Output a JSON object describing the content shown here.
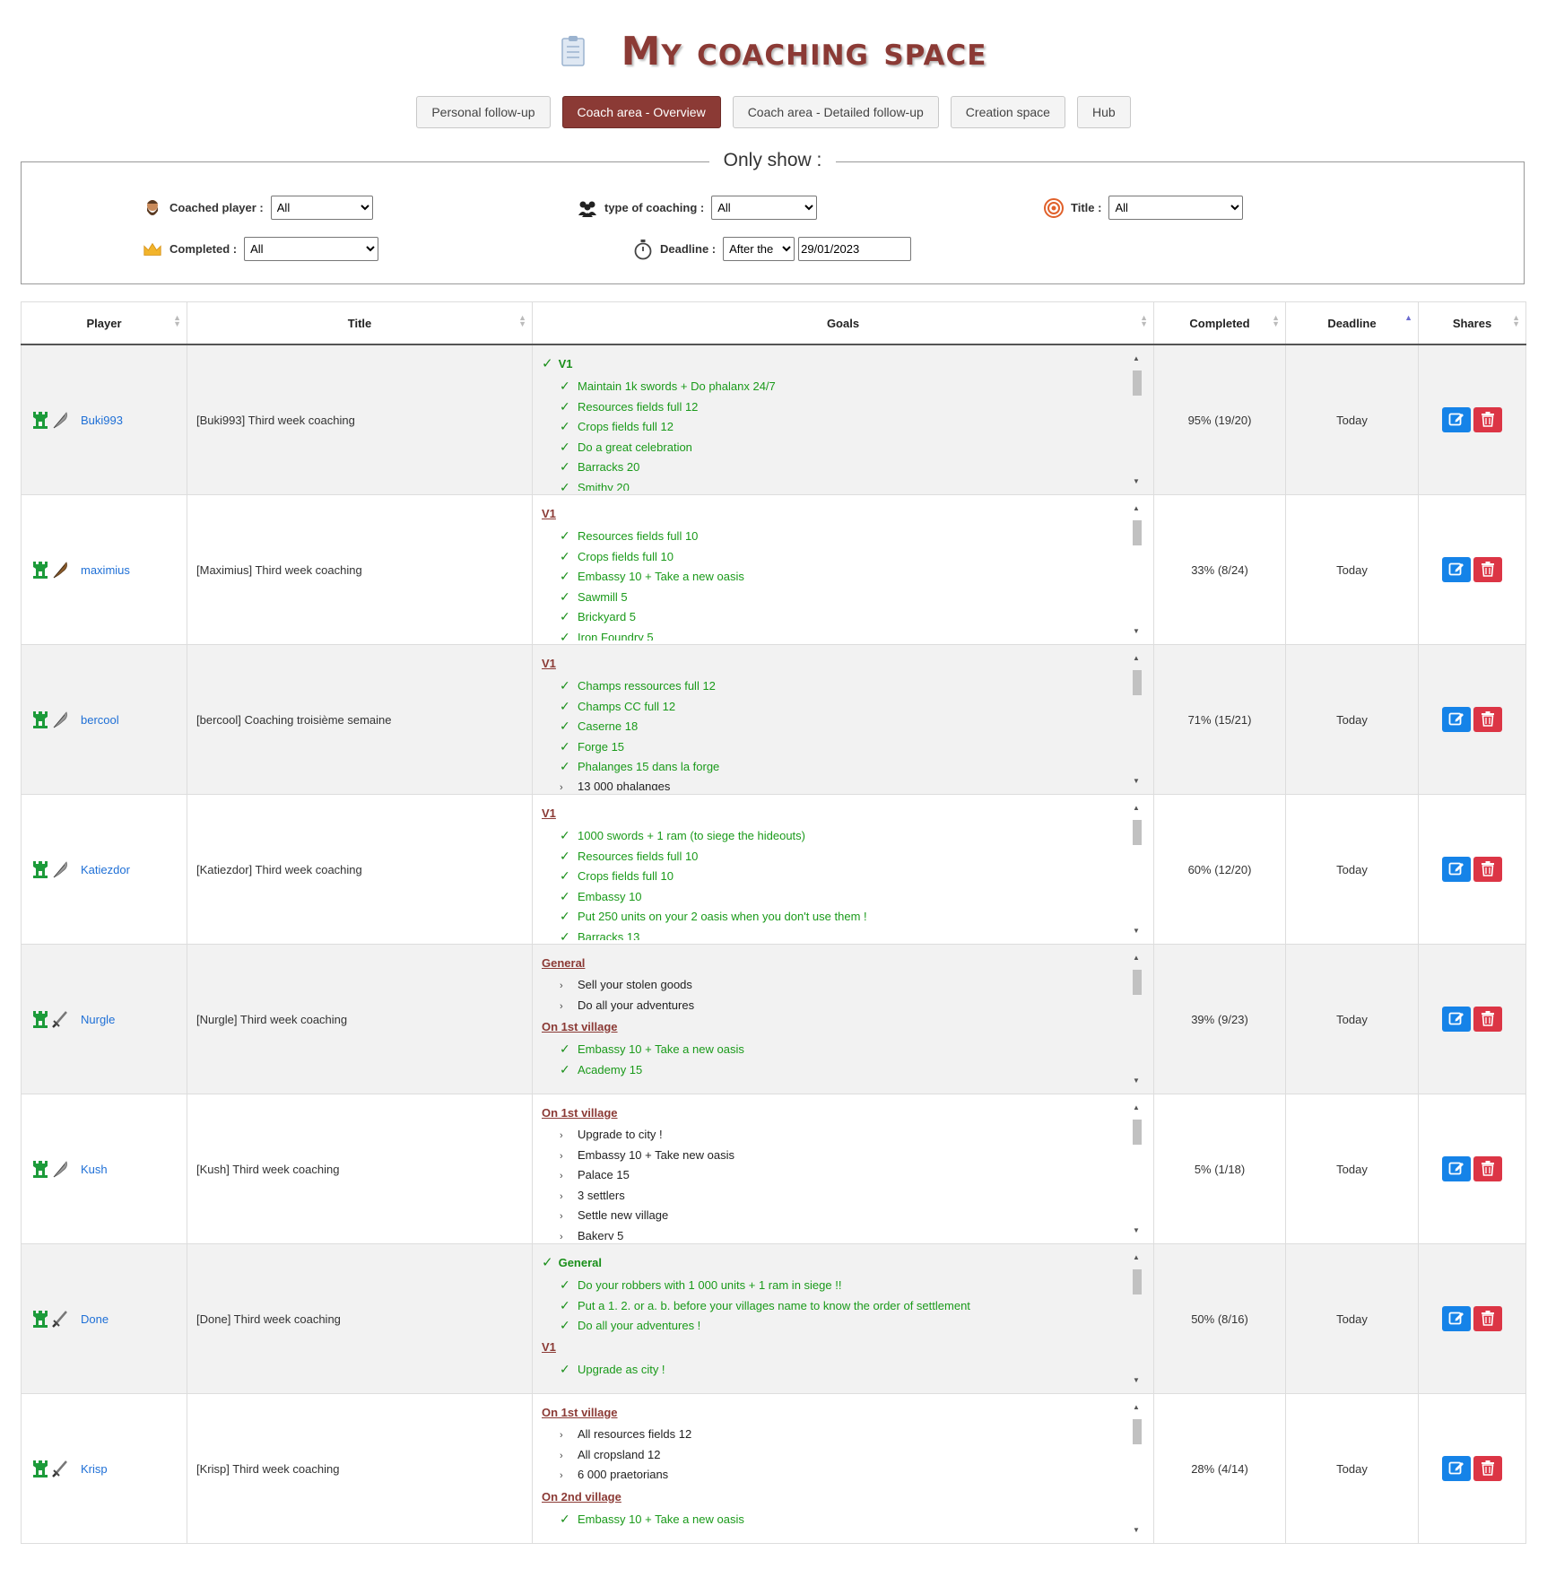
{
  "page": {
    "title": "My coaching space"
  },
  "tabs": [
    {
      "label": "Personal follow-up",
      "active": false
    },
    {
      "label": "Coach area - Overview",
      "active": true
    },
    {
      "label": "Coach area - Detailed follow-up",
      "active": false
    },
    {
      "label": "Creation space",
      "active": false
    },
    {
      "label": "Hub",
      "active": false
    }
  ],
  "filters": {
    "legend": "Only show :",
    "coached_player": {
      "label": "Coached player :",
      "value": "All"
    },
    "type": {
      "label": "type of coaching :",
      "value": "All"
    },
    "title": {
      "label": "Title :",
      "value": "All"
    },
    "completed": {
      "label": "Completed :",
      "value": "All"
    },
    "deadline": {
      "label": "Deadline :",
      "mode": "After the",
      "date": "29/01/2023"
    }
  },
  "table": {
    "headers": [
      "Player",
      "Title",
      "Goals",
      "Completed",
      "Deadline",
      "Shares"
    ],
    "rows": [
      {
        "player": "Buki993",
        "title": "[Buki993] Third week coaching",
        "completed": "95% (19/20)",
        "deadline": "Today",
        "goals": [
          {
            "type": "head",
            "text": "V1",
            "done": true
          },
          {
            "type": "item",
            "text": "Maintain 1k swords + Do phalanx 24/7",
            "done": true
          },
          {
            "type": "item",
            "text": "Resources fields full 12",
            "done": true
          },
          {
            "type": "item",
            "text": "Crops fields full 12",
            "done": true
          },
          {
            "type": "item",
            "text": "Do a great celebration",
            "done": true
          },
          {
            "type": "item",
            "text": "Barracks 20",
            "done": true
          },
          {
            "type": "item",
            "text": "Smithy 20",
            "done": true
          }
        ]
      },
      {
        "player": "maximius",
        "title": "[Maximius] Third week coaching",
        "completed": "33% (8/24)",
        "deadline": "Today",
        "goals": [
          {
            "type": "head",
            "text": "V1",
            "done": false
          },
          {
            "type": "item",
            "text": "Resources fields full 10",
            "done": true
          },
          {
            "type": "item",
            "text": "Crops fields full 10",
            "done": true
          },
          {
            "type": "item",
            "text": "Embassy 10 + Take a new oasis",
            "done": true
          },
          {
            "type": "item",
            "text": "Sawmill 5",
            "done": true
          },
          {
            "type": "item",
            "text": "Brickyard 5",
            "done": true
          },
          {
            "type": "item",
            "text": "Iron Foundry 5",
            "done": true
          }
        ]
      },
      {
        "player": "bercool",
        "title": "[bercool] Coaching troisième semaine",
        "completed": "71% (15/21)",
        "deadline": "Today",
        "goals": [
          {
            "type": "head",
            "text": "V1",
            "done": false
          },
          {
            "type": "item",
            "text": "Champs ressources full 12",
            "done": true
          },
          {
            "type": "item",
            "text": "Champs CC full 12",
            "done": true
          },
          {
            "type": "item",
            "text": "Caserne 18",
            "done": true
          },
          {
            "type": "item",
            "text": "Forge 15",
            "done": true
          },
          {
            "type": "item",
            "text": "Phalanges 15 dans la forge",
            "done": true
          },
          {
            "type": "item",
            "text": "13 000 phalanges",
            "done": false
          }
        ]
      },
      {
        "player": "Katiezdor",
        "title": "[Katiezdor] Third week coaching",
        "completed": "60% (12/20)",
        "deadline": "Today",
        "goals": [
          {
            "type": "head",
            "text": "V1",
            "done": false
          },
          {
            "type": "item",
            "text": "1000 swords + 1 ram (to siege the hideouts)",
            "done": true
          },
          {
            "type": "item",
            "text": "Resources fields full 10",
            "done": true
          },
          {
            "type": "item",
            "text": "Crops fields full 10",
            "done": true
          },
          {
            "type": "item",
            "text": "Embassy 10",
            "done": true
          },
          {
            "type": "item",
            "text": "Put 250 units on your 2 oasis when you don't use them !",
            "done": true
          },
          {
            "type": "item",
            "text": "Barracks 13",
            "done": true
          }
        ]
      },
      {
        "player": "Nurgle",
        "title": "[Nurgle] Third week coaching",
        "completed": "39% (9/23)",
        "deadline": "Today",
        "goals": [
          {
            "type": "head",
            "text": "General",
            "done": false
          },
          {
            "type": "item",
            "text": "Sell your stolen goods",
            "done": false
          },
          {
            "type": "item",
            "text": "Do all your adventures",
            "done": false
          },
          {
            "type": "head",
            "text": "On 1st village",
            "done": false
          },
          {
            "type": "item",
            "text": "Embassy 10 + Take a new oasis",
            "done": true
          },
          {
            "type": "item",
            "text": "Academy 15",
            "done": true
          }
        ]
      },
      {
        "player": "Kush",
        "title": "[Kush] Third week coaching",
        "completed": "5% (1/18)",
        "deadline": "Today",
        "goals": [
          {
            "type": "head",
            "text": "On 1st village",
            "done": false
          },
          {
            "type": "item",
            "text": "Upgrade to city !",
            "done": false
          },
          {
            "type": "item",
            "text": "Embassy 10 + Take new oasis",
            "done": false
          },
          {
            "type": "item",
            "text": "Palace 15",
            "done": false
          },
          {
            "type": "item",
            "text": "3 settlers",
            "done": false
          },
          {
            "type": "item",
            "text": "Settle new village",
            "done": false
          },
          {
            "type": "item",
            "text": "Bakery 5",
            "done": false
          }
        ]
      },
      {
        "player": "Done",
        "title": "[Done] Third week coaching",
        "completed": "50% (8/16)",
        "deadline": "Today",
        "goals": [
          {
            "type": "head",
            "text": "General",
            "done": true
          },
          {
            "type": "item",
            "text": "Do your robbers with 1 000 units + 1 ram in siege !!",
            "done": true
          },
          {
            "type": "item",
            "text": "Put a 1. 2. or a. b. before your villages name to know the order of settlement",
            "done": true
          },
          {
            "type": "item",
            "text": "Do all your adventures !",
            "done": true
          },
          {
            "type": "head",
            "text": "V1",
            "done": false
          },
          {
            "type": "item",
            "text": "Upgrade as city !",
            "done": true
          }
        ]
      },
      {
        "player": "Krisp",
        "title": "[Krisp] Third week coaching",
        "completed": "28% (4/14)",
        "deadline": "Today",
        "goals": [
          {
            "type": "head",
            "text": "On 1st village",
            "done": false
          },
          {
            "type": "item",
            "text": "All resources fields 12",
            "done": false
          },
          {
            "type": "item",
            "text": "All cropsland 12",
            "done": false
          },
          {
            "type": "item",
            "text": "6 000 praetorians",
            "done": false
          },
          {
            "type": "head",
            "text": "On 2nd village",
            "done": false
          },
          {
            "type": "item",
            "text": "Embassy 10 + Take a new oasis",
            "done": true
          }
        ]
      }
    ]
  },
  "icons": {
    "player_type": "green-tower-icon",
    "feather": "feather-icon",
    "sword": "sword-icon",
    "edit": "edit-icon",
    "delete": "trash-icon"
  },
  "colors": {
    "brand": "#8b3a35",
    "done": "#1a8f1a",
    "link": "#1e6fd6",
    "edit": "#1583e8",
    "delete": "#dc3545"
  }
}
